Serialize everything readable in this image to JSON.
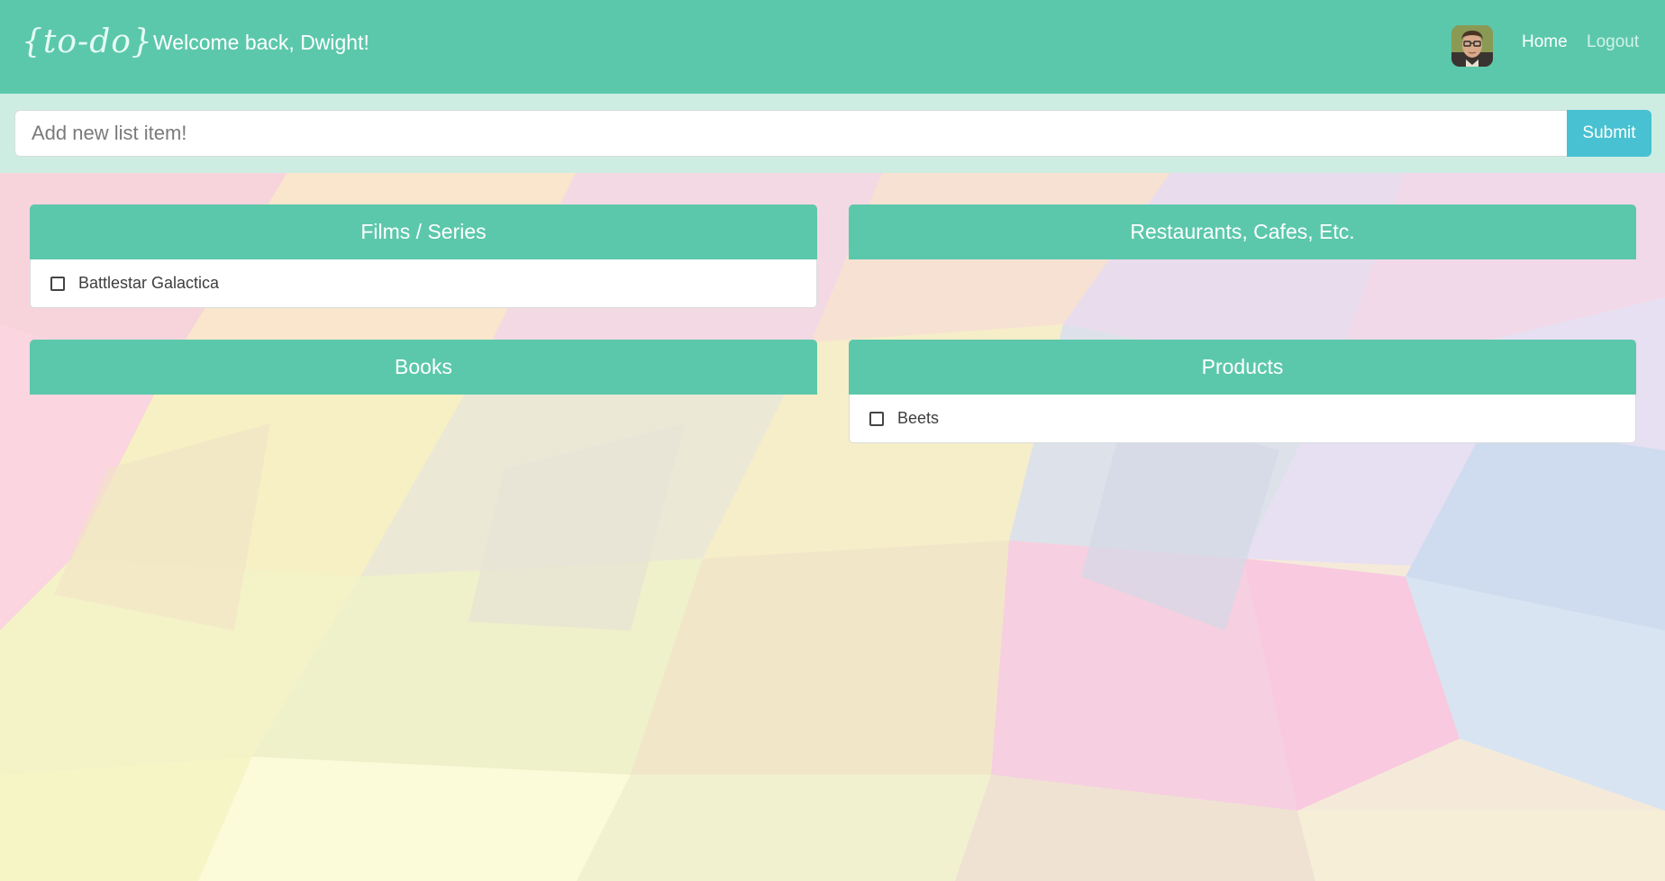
{
  "app": {
    "logo_text": "{to-do}",
    "welcome_text": "Welcome back, Dwight!"
  },
  "nav": {
    "home_label": "Home",
    "logout_label": "Logout"
  },
  "add_item": {
    "placeholder": "Add new list item!",
    "value": "",
    "submit_label": "Submit"
  },
  "categories": [
    {
      "title": "Films / Series",
      "items": [
        {
          "label": "Battlestar Galactica",
          "checked": false
        }
      ]
    },
    {
      "title": "Restaurants, Cafes, Etc.",
      "items": []
    },
    {
      "title": "Books",
      "items": []
    },
    {
      "title": "Products",
      "items": [
        {
          "label": "Beets",
          "checked": false
        }
      ]
    }
  ],
  "colors": {
    "header_bg": "#5cc8ab",
    "card_header_bg": "#5cc8ab",
    "submit_bg": "#48c1d2",
    "addbar_bg": "#cdece2"
  },
  "icons": {
    "avatar": "user-avatar-photo",
    "checkbox": "checkbox-unchecked-icon"
  }
}
